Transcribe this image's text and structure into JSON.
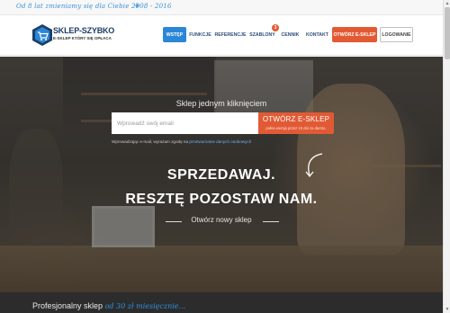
{
  "topbar": {
    "notice": "Od 8 lat zmieniamy się dla Ciebie 2008 - 2016",
    "plane_icon": "paper-plane-icon"
  },
  "logo": {
    "brand": "SKLEP-SZYBKO",
    "tagline": "E-SKLEP KTÓRY SIĘ OPŁACA",
    "icon": "cart-hexagon-icon"
  },
  "nav": {
    "items": [
      "WSTĘP",
      "FUNKCJE",
      "REFERENCJE",
      "SZABLONY",
      "CENNIK",
      "KONTAKT"
    ],
    "badge": "3",
    "cta_label": "OTWÓRZ E-SKLEP",
    "login_label": "LOGOWANIE"
  },
  "hero": {
    "lead": "Sklep jednym kliknięciem",
    "email_placeholder": "Wprowadź swój email",
    "button_label": "OTWÓRZ E-SKLEP",
    "button_sub": "pełna wersja przez 15 dni za darmo.",
    "consent_text": "Wprowadzając e-mail, wyrażam zgodę na",
    "consent_link": "przetwarzanie danych osobowych",
    "headline_1": "SPRZEDAWAJ.",
    "headline_2": "RESZTĘ POZOSTAW NAM.",
    "sub": "Otwórz nowy sklep",
    "arrow_icon": "curved-arrow-icon"
  },
  "strip": {
    "text": "Profesjonalny sklep",
    "price": "od 30 zł miesięcznie..."
  },
  "colors": {
    "accent": "#e15a35",
    "primary": "#2b86d8",
    "navy": "#1d3f66"
  }
}
